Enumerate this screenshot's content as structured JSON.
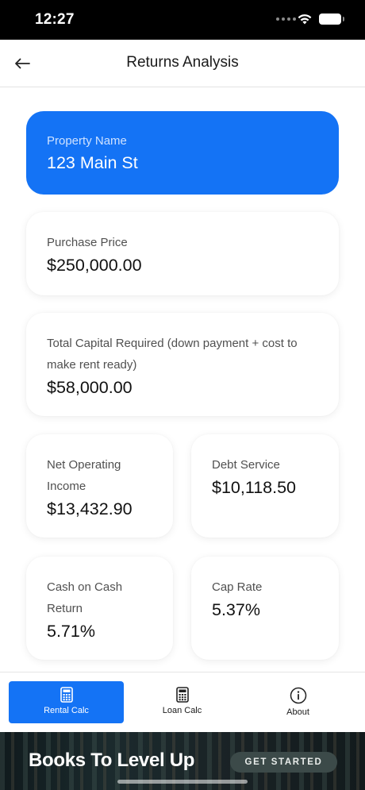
{
  "status_bar": {
    "time": "12:27"
  },
  "nav": {
    "title": "Returns Analysis"
  },
  "cards": {
    "property": {
      "label": "Property Name",
      "value": "123 Main St"
    },
    "purchase": {
      "label": "Purchase Price",
      "value": "$250,000.00"
    },
    "capital": {
      "label": "Total Capital Required (down payment + cost to make rent ready)",
      "value": "$58,000.00"
    },
    "noi": {
      "label": "Net Operating Income",
      "value": "$13,432.90"
    },
    "debt": {
      "label": "Debt Service",
      "value": "$10,118.50"
    },
    "coc": {
      "label": "Cash on Cash Return",
      "value": "5.71%"
    },
    "cap": {
      "label": "Cap Rate",
      "value": "5.37%"
    }
  },
  "tabs": [
    {
      "label": "Rental Calc",
      "icon": "calculator-icon",
      "active": true
    },
    {
      "label": "Loan Calc",
      "icon": "calculator-icon",
      "active": false
    },
    {
      "label": "About",
      "icon": "info-icon",
      "active": false
    }
  ],
  "banner": {
    "title": "Books To Level Up",
    "cta": "GET STARTED"
  },
  "colors": {
    "accent": "#1473f5",
    "status_bar": "#000000",
    "background": "#ffffff"
  }
}
